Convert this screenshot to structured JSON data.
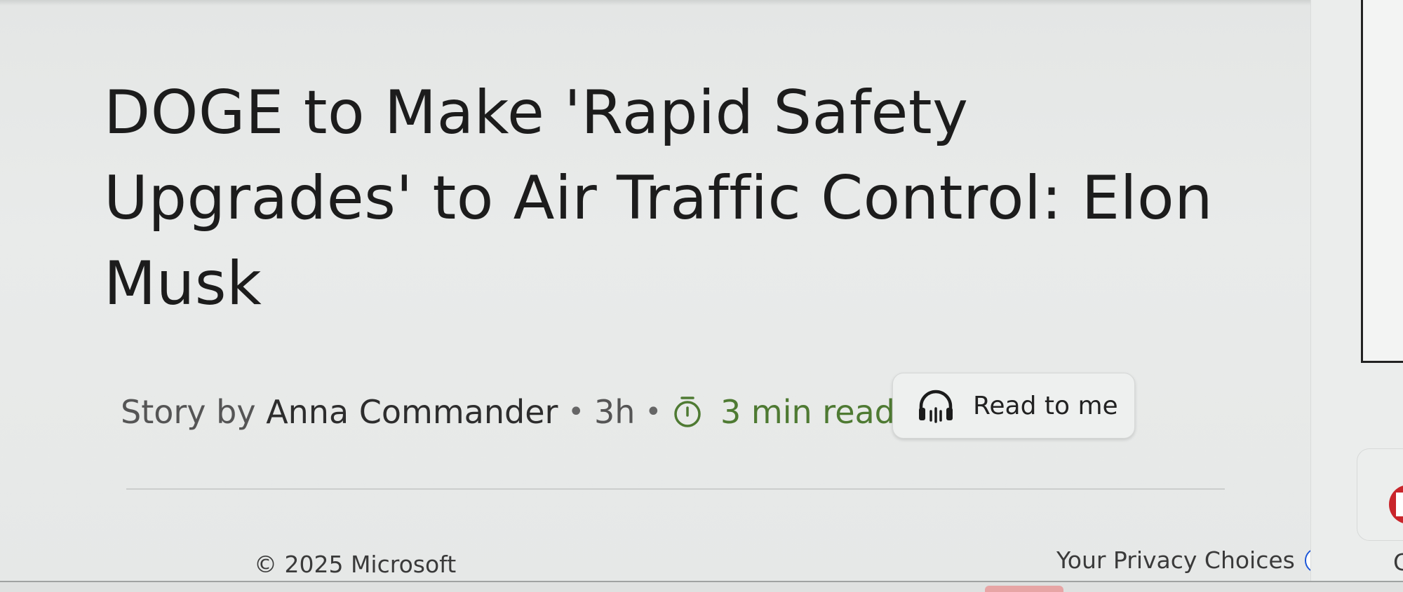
{
  "article": {
    "headline": "DOGE to Make 'Rapid Safety Upgrades' to Air Traffic Control: Elon Musk",
    "byline_prefix": "Story by",
    "author": "Anna Commander",
    "separator": "•",
    "age": "3h",
    "read_time": "3 min read",
    "read_time_icon": "stopwatch-icon",
    "read_time_color": "#4e7a32"
  },
  "read_to_me": {
    "label": "Read to me",
    "icon": "headphones-icon"
  },
  "footer": {
    "copyright": "© 2025 Microsoft",
    "privacy_label": "Your Privacy Choices",
    "privacy_icon": "privacy-choices-toggle-icon",
    "privacy_accent": "#1a55d8",
    "cut_off_text": "C"
  }
}
